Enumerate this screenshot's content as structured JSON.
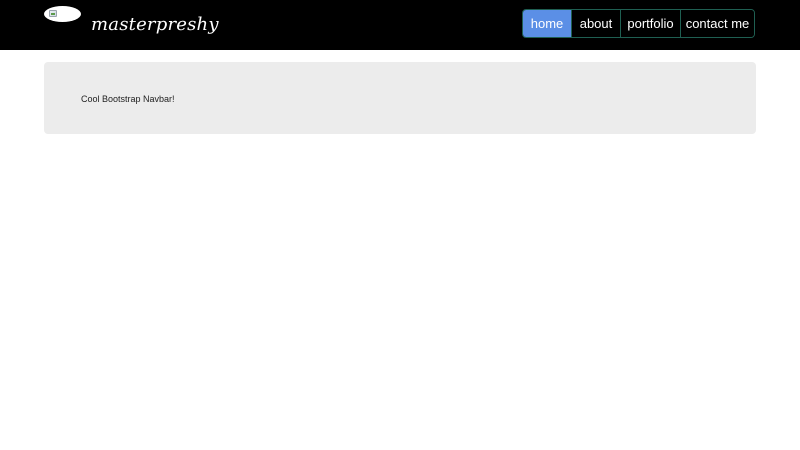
{
  "navbar": {
    "brand": "masterpreshy",
    "links": [
      {
        "label": "home",
        "active": true
      },
      {
        "label": "about",
        "active": false
      },
      {
        "label": "portfolio",
        "active": false
      },
      {
        "label": "contact me",
        "active": false
      }
    ]
  },
  "jumbotron": {
    "text": "Cool Bootstrap Navbar!"
  },
  "colors": {
    "navbar_bg": "#000000",
    "active_link_bg": "#5b8fe6",
    "nav_border": "#1f5f52",
    "jumbotron_bg": "#ececec"
  }
}
